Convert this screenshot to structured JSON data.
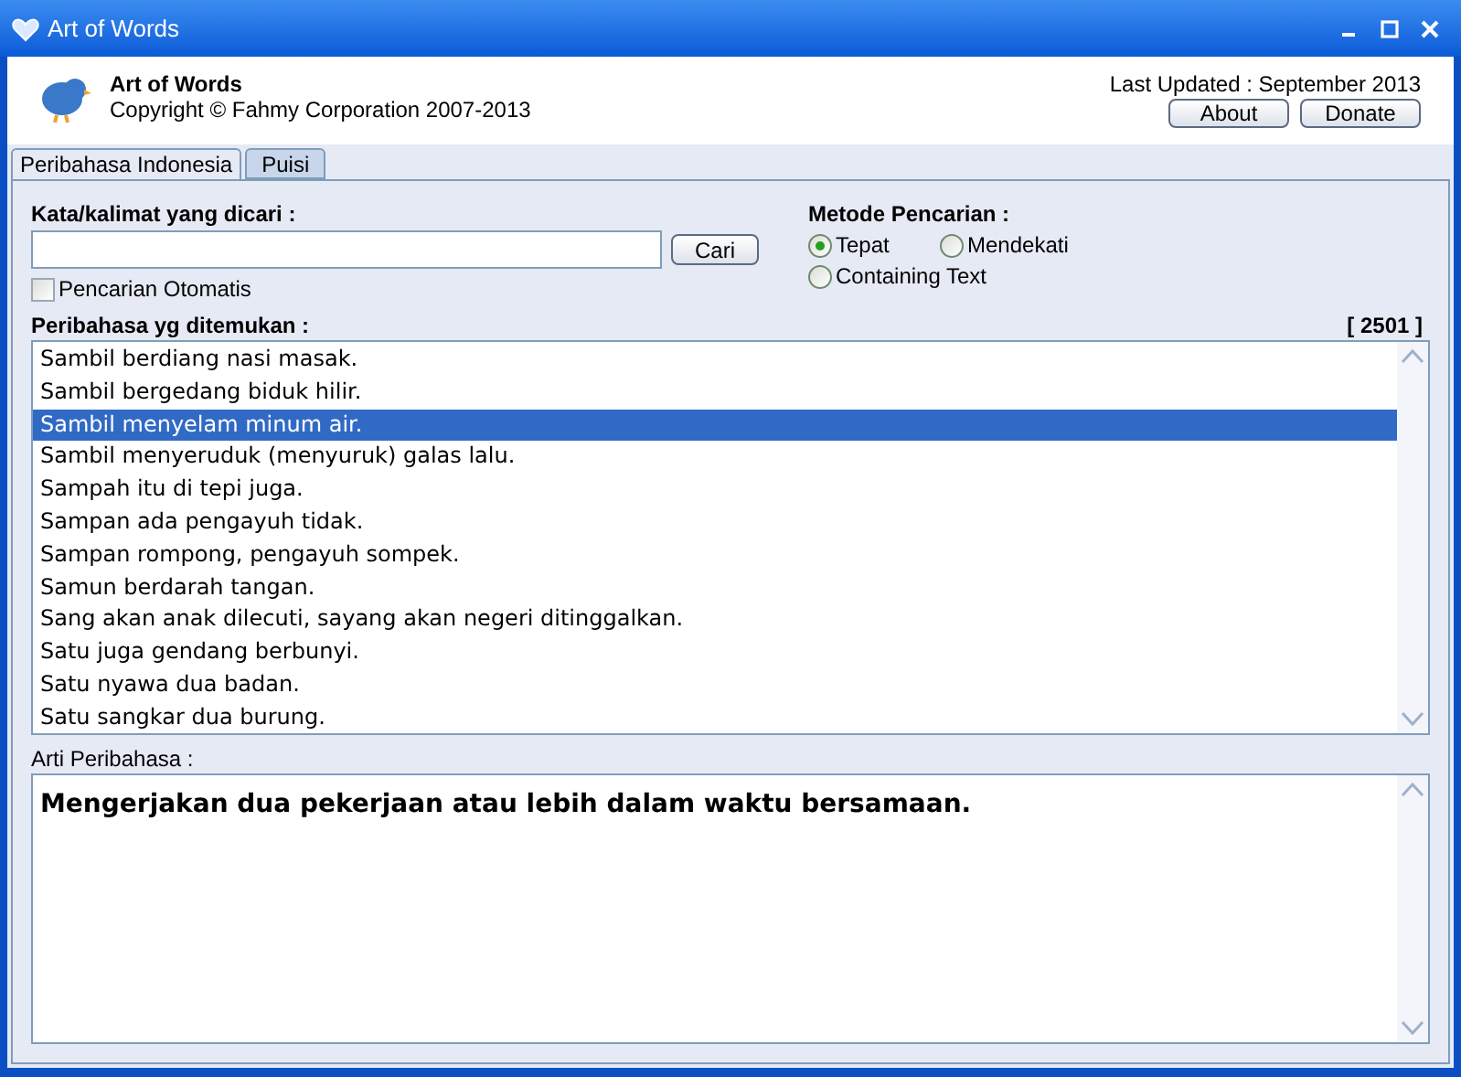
{
  "window": {
    "title": "Art of Words"
  },
  "header": {
    "app_name": "Art of Words",
    "copyright": "Copyright © Fahmy Corporation 2007-2013",
    "last_updated": "Last Updated : September 2013",
    "buttons": [
      "About",
      "Donate"
    ]
  },
  "tabs": [
    {
      "label": "Peribahasa Indonesia",
      "selected": true
    },
    {
      "label": "Puisi",
      "selected": false
    }
  ],
  "search": {
    "label": "Kata/kalimat yang dicari :",
    "button": "Cari",
    "auto": {
      "label": "Pencarian Otomatis",
      "checked": false
    }
  },
  "method": {
    "label": "Metode Pencarian :",
    "options": [
      {
        "label": "Tepat",
        "selected": true
      },
      {
        "label": "Mendekati",
        "selected": false
      },
      {
        "label": "Containing Text",
        "selected": false
      }
    ]
  },
  "results": {
    "label": "Peribahasa yg ditemukan :",
    "count": "[ 2501 ]",
    "items": [
      {
        "text": "Sambil berdiang nasi masak.",
        "selected": false
      },
      {
        "text": "Sambil bergedang biduk hilir.",
        "selected": false
      },
      {
        "text": "Sambil menyelam minum air.",
        "selected": true
      },
      {
        "text": "Sambil menyeruduk (menyuruk) galas lalu.",
        "selected": false
      },
      {
        "text": "Sampah itu di tepi juga.",
        "selected": false
      },
      {
        "text": "Sampan ada pengayuh tidak.",
        "selected": false
      },
      {
        "text": "Sampan rompong, pengayuh sompek.",
        "selected": false
      },
      {
        "text": "Samun berdarah tangan.",
        "selected": false
      },
      {
        "text": "Sang akan anak dilecuti, sayang akan negeri ditinggalkan.",
        "selected": false
      },
      {
        "text": "Satu juga gendang berbunyi.",
        "selected": false
      },
      {
        "text": "Satu nyawa dua badan.",
        "selected": false
      },
      {
        "text": "Satu sangkar dua burung.",
        "selected": false
      }
    ]
  },
  "meaning": {
    "label": "Arti Peribahasa :",
    "text": "Mengerjakan dua pekerjaan atau lebih dalam waktu bersamaan."
  }
}
